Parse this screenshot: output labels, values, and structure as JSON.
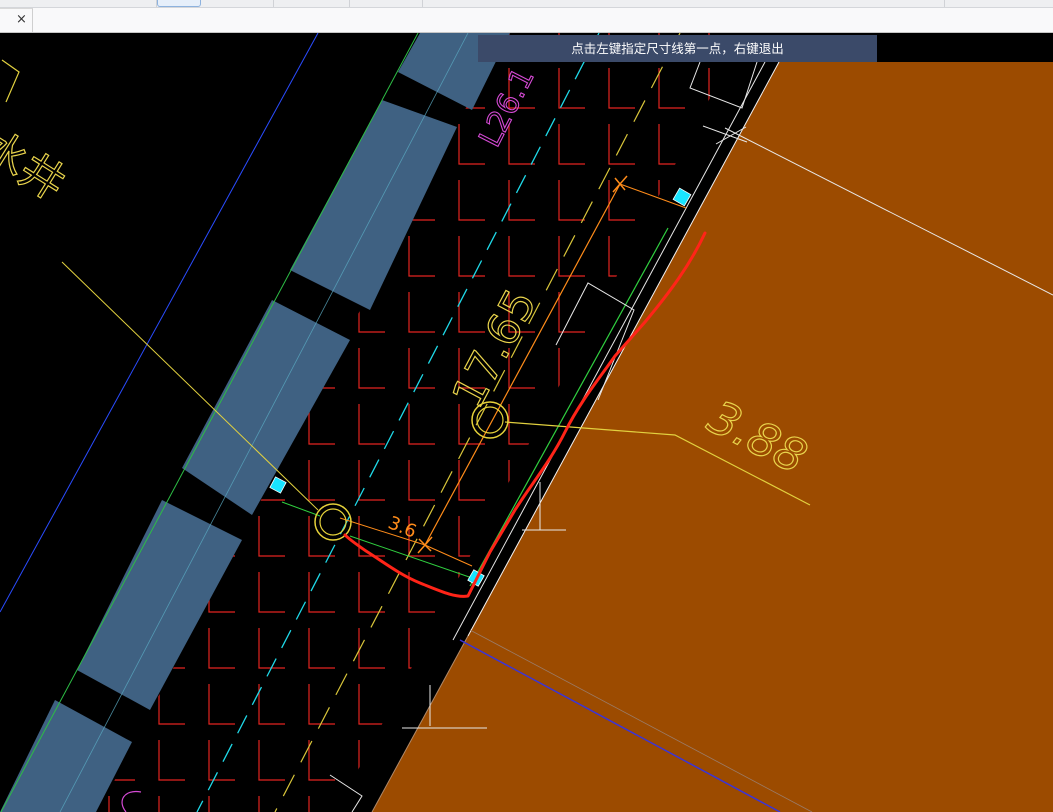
{
  "window": {
    "close_icon": "close-icon",
    "close_glyph": "×"
  },
  "prompt": {
    "text": "点击左键指定尺寸线第一点，右键退出"
  },
  "drawing": {
    "pipe_label": "L26.1",
    "well_label": "水井",
    "dimensions": {
      "main_length": "17.65",
      "right_offset": "3.88",
      "small_offset": "3.6"
    },
    "colors": {
      "soil": "#9c4b00",
      "paving": "#3f6182",
      "hatch": "#e3241f",
      "markup": "#ff2418",
      "marker": "#18e4ff",
      "dimension": "#e9d44c",
      "dimension_small": "#ff8c1a",
      "pipe_label": "#d54ad5"
    }
  }
}
